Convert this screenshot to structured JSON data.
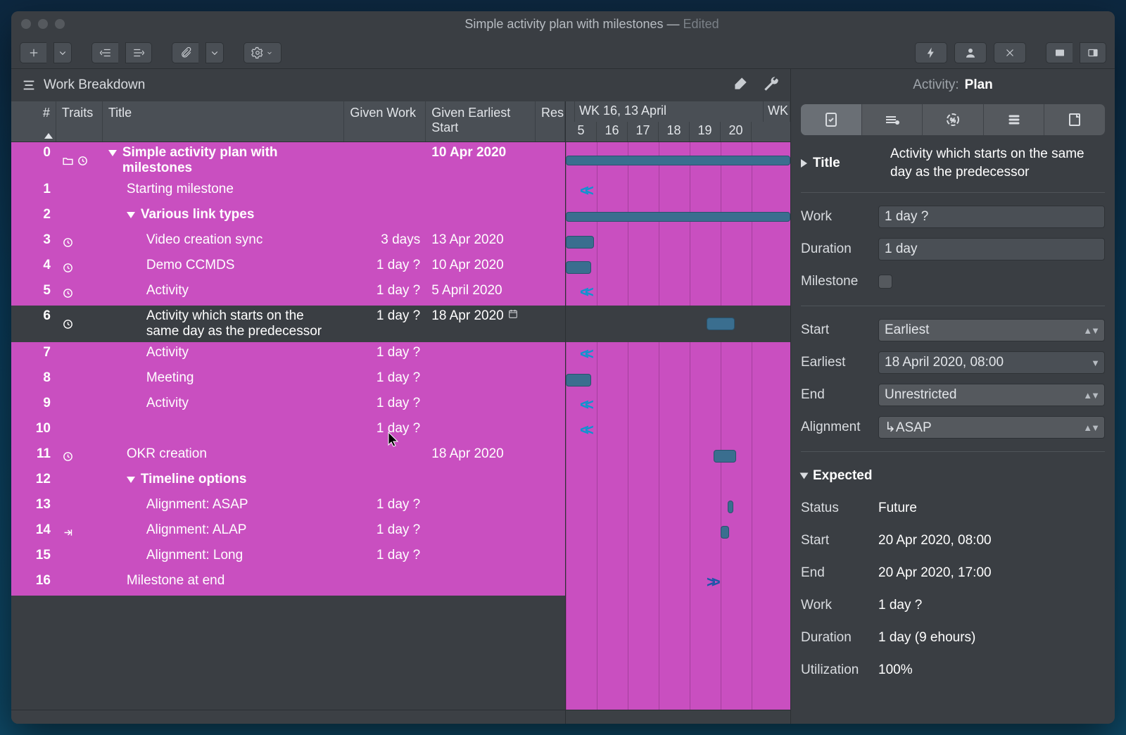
{
  "window": {
    "title": "Simple activity plan with milestones",
    "edited": "Edited"
  },
  "wbs": {
    "label": "Work Breakdown",
    "columns": {
      "num": "#",
      "traits": "Traits",
      "title": "Title",
      "work": "Given Work",
      "start": "Given Earliest Start",
      "res": "Res"
    },
    "rows": [
      {
        "n": "0",
        "title": "Simple activity plan with milestones",
        "work": "",
        "start": "10 Apr 2020",
        "bold": true,
        "indent": 0,
        "disclose": true,
        "traits": [
          "folder",
          "clock"
        ]
      },
      {
        "n": "1",
        "title": "Starting milestone",
        "work": "",
        "start": "",
        "indent": 1
      },
      {
        "n": "2",
        "title": "Various link types",
        "work": "",
        "start": "",
        "bold": true,
        "indent": 1,
        "disclose": true
      },
      {
        "n": "3",
        "title": "Video creation sync",
        "work": "3 days",
        "start": "13 Apr 2020",
        "indent": 2,
        "traits": [
          "clock"
        ]
      },
      {
        "n": "4",
        "title": "Demo CCMDS",
        "work": "1 day ?",
        "start": "10 Apr 2020",
        "indent": 2,
        "traits": [
          "clock"
        ]
      },
      {
        "n": "5",
        "title": "Activity",
        "work": "1 day ?",
        "start": "5 April 2020",
        "indent": 2,
        "traits": [
          "clock"
        ]
      },
      {
        "n": "6",
        "title": "Activity which starts on the same day as the predecessor",
        "work": "1 day ?",
        "start": "18 Apr 2020",
        "indent": 2,
        "traits": [
          "clock"
        ],
        "calendar": true,
        "selected": true
      },
      {
        "n": "7",
        "title": "Activity",
        "work": "1 day ?",
        "start": "",
        "indent": 2
      },
      {
        "n": "8",
        "title": "Meeting",
        "work": "1 day ?",
        "start": "",
        "indent": 2
      },
      {
        "n": "9",
        "title": "Activity",
        "work": "1 day ?",
        "start": "",
        "indent": 2
      },
      {
        "n": "10",
        "title": "",
        "work": "1 day ?",
        "start": "",
        "indent": 2
      },
      {
        "n": "11",
        "title": "OKR creation",
        "work": "",
        "start": "18 Apr 2020",
        "indent": 1,
        "traits": [
          "clock"
        ]
      },
      {
        "n": "12",
        "title": "Timeline options",
        "work": "",
        "start": "",
        "bold": true,
        "indent": 1,
        "disclose": true
      },
      {
        "n": "13",
        "title": "Alignment: ASAP",
        "work": "1 day ?",
        "start": "",
        "indent": 2
      },
      {
        "n": "14",
        "title": "Alignment: ALAP",
        "work": "1 day ?",
        "start": "",
        "indent": 2,
        "traits": [
          "alap"
        ]
      },
      {
        "n": "15",
        "title": "Alignment: Long",
        "work": "1 day ?",
        "start": "",
        "indent": 2
      },
      {
        "n": "16",
        "title": "Milestone at end",
        "work": "",
        "start": "",
        "indent": 1
      }
    ]
  },
  "timeline": {
    "week_label": "WK 16, 13 April",
    "wk_next": "WK",
    "days": [
      "5",
      "16",
      "17",
      "18",
      "19",
      "20"
    ]
  },
  "inspector": {
    "header_label": "Activity:",
    "header_value": "Plan",
    "title_label": "Title",
    "title_value": "Activity which starts on the same day as the predecessor",
    "work_label": "Work",
    "work_value": "1 day ?",
    "duration_label": "Duration",
    "duration_value": "1 day",
    "milestone_label": "Milestone",
    "start_label": "Start",
    "start_value": "Earliest",
    "earliest_label": "Earliest",
    "earliest_value": "18 April 2020, 08:00",
    "end_label": "End",
    "end_value": "Unrestricted",
    "alignment_label": "Alignment",
    "alignment_value": "↳ASAP",
    "expected_label": "Expected",
    "status_label": "Status",
    "status_value": "Future",
    "exp_start_label": "Start",
    "exp_start_value": "20 Apr 2020, 08:00",
    "exp_end_label": "End",
    "exp_end_value": "20 Apr 2020, 17:00",
    "exp_work_label": "Work",
    "exp_work_value": "1 day ?",
    "exp_duration_label": "Duration",
    "exp_duration_value": "1 day (9 ehours)",
    "util_label": "Utilization",
    "util_value": "100%"
  }
}
